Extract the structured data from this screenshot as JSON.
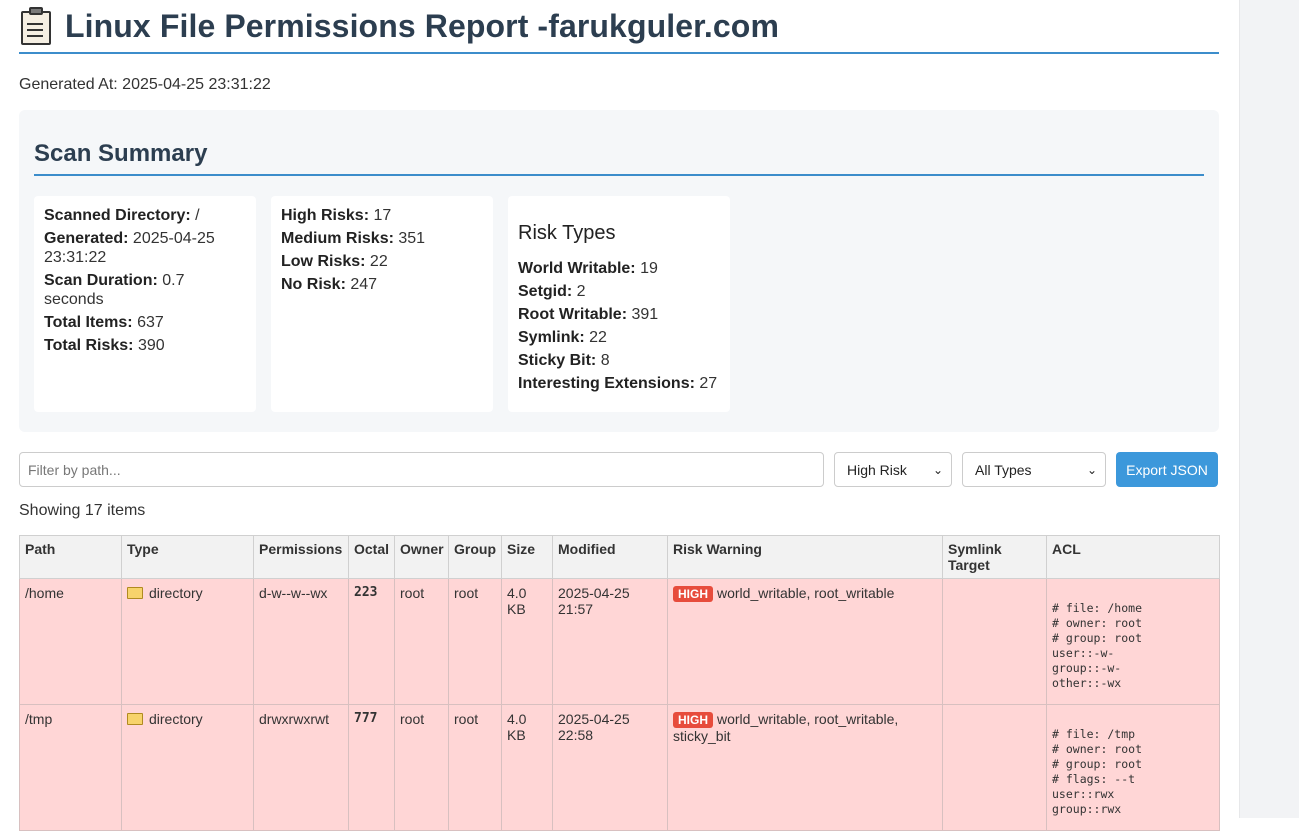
{
  "header": {
    "icon": "clipboard-icon",
    "title": "Linux File Permissions Report -farukguler.com",
    "generated_label": "Generated At: 2025-04-25 23:31:22"
  },
  "summary": {
    "title": "Scan Summary",
    "card1": {
      "scanned_dir_label": "Scanned Directory:",
      "scanned_dir_value": "/",
      "generated_label": "Generated:",
      "generated_value": "2025-04-25 23:31:22",
      "duration_label": "Scan Duration:",
      "duration_value": "0.7 seconds",
      "total_items_label": "Total Items:",
      "total_items_value": "637",
      "total_risks_label": "Total Risks:",
      "total_risks_value": "390"
    },
    "card2": {
      "high_label": "High Risks:",
      "high_value": "17",
      "medium_label": "Medium Risks:",
      "medium_value": "351",
      "low_label": "Low Risks:",
      "low_value": "22",
      "none_label": "No Risk:",
      "none_value": "247"
    },
    "card3": {
      "title": "Risk Types",
      "world_label": "World Writable:",
      "world_value": "19",
      "setgid_label": "Setgid:",
      "setgid_value": "2",
      "root_label": "Root Writable:",
      "root_value": "391",
      "symlink_label": "Symlink:",
      "symlink_value": "22",
      "sticky_label": "Sticky Bit:",
      "sticky_value": "8",
      "ext_label": "Interesting Extensions:",
      "ext_value": "27"
    }
  },
  "filters": {
    "path_placeholder": "Filter by path...",
    "risk_selected": "High Risk",
    "type_selected": "All Types",
    "export_label": "Export JSON"
  },
  "showing": "Showing 17 items",
  "table": {
    "headers": [
      "Path",
      "Type",
      "Permissions",
      "Octal",
      "Owner",
      "Group",
      "Size",
      "Modified",
      "Risk Warning",
      "Symlink Target",
      "ACL"
    ],
    "rows": [
      {
        "path": "/home",
        "type": "directory",
        "permissions": "d-w--w--wx",
        "octal": "223",
        "owner": "root",
        "group": "root",
        "size": "4.0 KB",
        "modified": "2025-04-25 21:57",
        "risk_badge": "HIGH",
        "risk_text": "world_writable, root_writable",
        "symlink": "",
        "acl": "# file: /home\n# owner: root\n# group: root\nuser::-w-\ngroup::-w-\nother::-wx"
      },
      {
        "path": "/tmp",
        "type": "directory",
        "permissions": "drwxrwxrwt",
        "octal": "777",
        "owner": "root",
        "group": "root",
        "size": "4.0 KB",
        "modified": "2025-04-25 22:58",
        "risk_badge": "HIGH",
        "risk_text": "world_writable, root_writable, sticky_bit",
        "symlink": "",
        "acl": "# file: /tmp\n# owner: root\n# group: root\n# flags: --t\nuser::rwx\ngroup::rwx"
      }
    ]
  },
  "colors": {
    "accent": "#3c8dcb",
    "button": "#3c98db",
    "high_badge": "#e74c3c",
    "high_row": "#ffd6d6",
    "title": "#2c3e50"
  }
}
